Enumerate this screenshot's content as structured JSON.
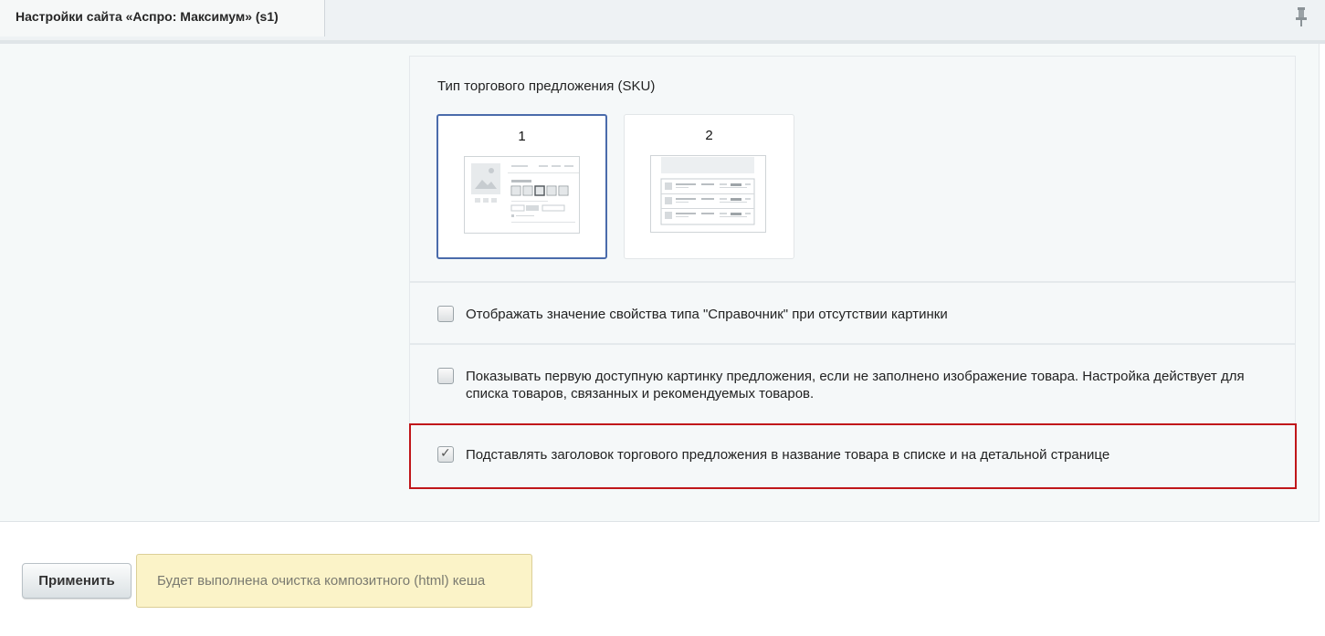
{
  "header": {
    "title": "Настройки сайта «Аспро: Максимум» (s1)"
  },
  "sku": {
    "title": "Тип торгового предложения (SKU)",
    "options": [
      {
        "label": "1",
        "selected": true
      },
      {
        "label": "2",
        "selected": false
      }
    ]
  },
  "options": [
    {
      "label": "Отображать значение свойства типа \"Справочник\" при отсутствии картинки",
      "checked": false
    },
    {
      "label": "Показывать первую доступную картинку предложения, если не заполнено изображение товара. Настройка действует для списка товаров, связанных и рекомендуемых товаров.",
      "checked": false
    },
    {
      "label": "Подставлять заголовок торгового предложения в название товара в списке и на детальной странице",
      "checked": true
    }
  ],
  "footer": {
    "apply_label": "Применить",
    "notice": "Будет выполнена очистка композитного (html) кеша"
  },
  "colors": {
    "highlight": "#c0161a",
    "selected_border": "#4a6bab",
    "notice_bg": "#fbf3c8"
  }
}
